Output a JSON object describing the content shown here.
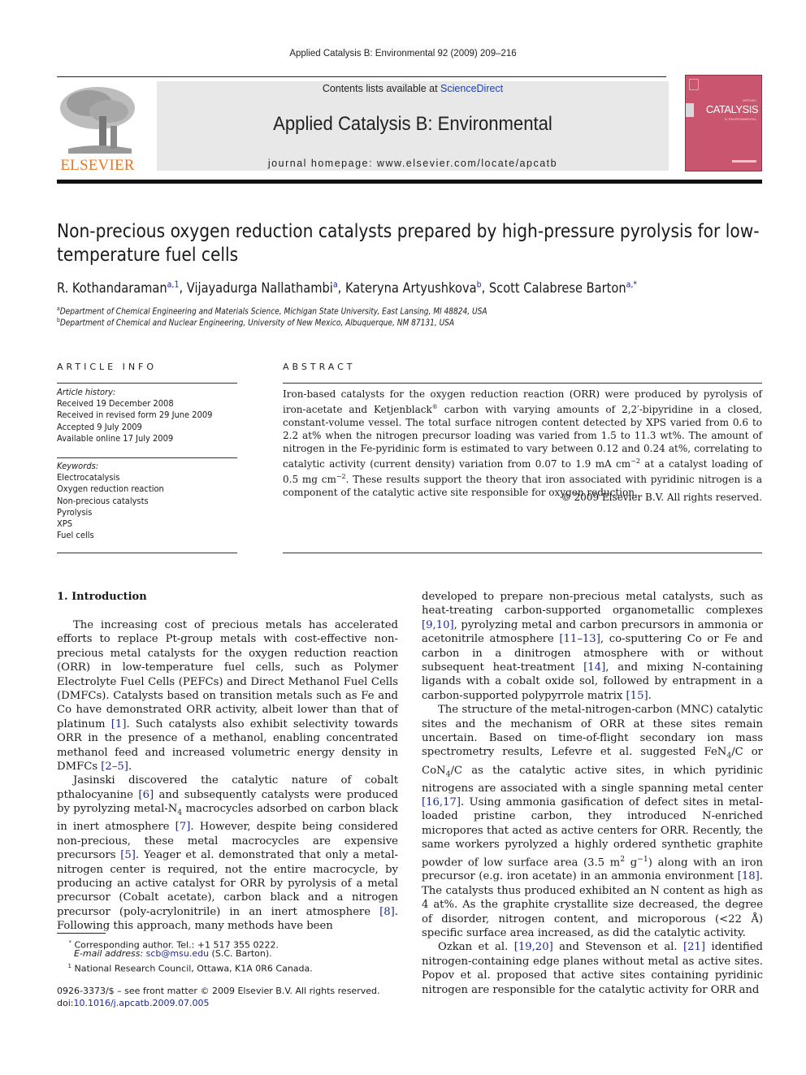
{
  "journal": {
    "running_head": "Applied Catalysis B: Environmental 92 (2009) 209–216",
    "contents_prefix": "Contents lists available at ",
    "contents_link": "ScienceDirect",
    "title": "Applied Catalysis B: Environmental",
    "homepage": "journal homepage: www.elsevier.com/locate/apcatb",
    "publisher_logo_text": "ELSEVIER",
    "cover": {
      "brand": "APPLIED",
      "title": "CATALYSIS",
      "subtitle": "B: ENVIRONMENTAL"
    },
    "colors": {
      "publisher_orange": "#e87722",
      "link_blue": "#1f2a8c",
      "cover_pink": "#c9566e",
      "banner_gray": "#e8e8e8"
    }
  },
  "article": {
    "title": "Non-precious oxygen reduction catalysts prepared by high-pressure pyrolysis for low-temperature fuel cells",
    "authors": [
      {
        "name": "R. Kothandaraman",
        "sup": "a,1",
        "sep": ", "
      },
      {
        "name": "Vijayadurga Nallathambi",
        "sup": "a",
        "sep": ", "
      },
      {
        "name": "Kateryna Artyushkova",
        "sup": "b",
        "sep": ", "
      },
      {
        "name": "Scott Calabrese Barton",
        "sup": "a,*",
        "sep": ""
      }
    ],
    "affiliations": [
      {
        "mark": "a",
        "text": "Department of Chemical Engineering and Materials Science, Michigan State University, East Lansing, MI 48824, USA"
      },
      {
        "mark": "b",
        "text": "Department of Chemical and Nuclear Engineering, University of New Mexico, Albuquerque, NM 87131, USA"
      }
    ]
  },
  "article_info": {
    "heading": "ARTICLE INFO",
    "history_label": "Article history:",
    "history": [
      "Received 19 December 2008",
      "Received in revised form 29 June 2009",
      "Accepted 9 July 2009",
      "Available online 17 July 2009"
    ],
    "keywords_label": "Keywords:",
    "keywords": [
      "Electrocatalysis",
      "Oxygen reduction reaction",
      "Non-precious catalysts",
      "Pyrolysis",
      "XPS",
      "Fuel cells"
    ]
  },
  "abstract": {
    "heading": "ABSTRACT",
    "p1": "Iron-based catalysts for the oxygen reduction reaction (ORR) were produced by pyrolysis of iron-acetate and Ketjenblack",
    "reg": "®",
    "p2": " carbon with varying amounts of 2,2′-bipyridine in a closed, constant-volume vessel. The total surface nitrogen content detected by XPS varied from 0.6 to 2.2 at% when the nitrogen precursor loading was varied from 1.5 to 11.3 wt%. The amount of nitrogen in the Fe-pyridinic form is estimated to vary between 0.12 and 0.24 at%, correlating to catalytic activity (current density) variation from 0.07 to 1.9 mA cm",
    "exp1": "−2",
    "p3": " at a catalyst loading of 0.5 mg cm",
    "exp2": "−2",
    "p4": ". These results support the theory that iron associated with pyridinic nitrogen is a component of the catalytic active site responsible for oxygen reduction.",
    "copyright": "© 2009 Elsevier B.V. All rights reserved."
  },
  "body": {
    "section_heading": "1.  Introduction",
    "left": {
      "p1": [
        {
          "t": "The increasing cost of precious metals has accelerated efforts to replace Pt-group metals with cost-effective non-precious metal catalysts for the oxygen reduction reaction (ORR) in low-temperature fuel cells, such as Polymer Electrolyte Fuel Cells (PEFCs) and Direct Methanol Fuel Cells (DMFCs). Catalysts based on transition metals such as Fe and Co have demonstrated ORR activity, albeit lower than that of platinum "
        },
        {
          "c": "[1]"
        },
        {
          "t": ". Such catalysts also exhibit selectivity towards ORR in the presence of a methanol, enabling concentrated methanol feed and increased volumetric energy density in DMFCs "
        },
        {
          "c": "[2–5]"
        },
        {
          "t": "."
        }
      ],
      "p2": [
        {
          "t": "Jasinski discovered the catalytic nature of cobalt pthalocyanine "
        },
        {
          "c": "[6]"
        },
        {
          "t": " and subsequently catalysts were produced by pyrolyzing metal-N"
        },
        {
          "s": "4"
        },
        {
          "t": " macrocycles adsorbed on carbon black in inert atmosphere "
        },
        {
          "c": "[7]"
        },
        {
          "t": ". However, despite being considered non-precious, these metal macrocycles are expensive precursors "
        },
        {
          "c": "[5]"
        },
        {
          "t": ". Yeager et al. demonstrated that only a metal-nitrogen center is required, not the entire macrocycle, by producing an active catalyst for ORR by pyrolysis of a metal precursor (Cobalt acetate), carbon black and a nitrogen precursor (poly-acrylonitrile) in an inert atmosphere "
        },
        {
          "c": "[8]"
        },
        {
          "t": ". Following this approach, many methods have been"
        }
      ]
    },
    "right": {
      "p1": [
        {
          "t": "developed to prepare non-precious metal catalysts, such as heat-treating carbon-supported organometallic complexes "
        },
        {
          "c": "[9,10]"
        },
        {
          "t": ", pyrolyzing metal and carbon precursors in ammonia or acetonitrile atmosphere "
        },
        {
          "c": "[11–13]"
        },
        {
          "t": ", co-sputtering Co or Fe and carbon in a dinitrogen atmosphere with or without subsequent heat-treatment "
        },
        {
          "c": "[14]"
        },
        {
          "t": ", and mixing N-containing ligands with a cobalt oxide sol, followed by entrapment in a carbon-supported polypyrrole matrix "
        },
        {
          "c": "[15]"
        },
        {
          "t": "."
        }
      ],
      "p2": [
        {
          "t": "The structure of the metal-nitrogen-carbon (MNC) catalytic sites and the mechanism of ORR at these sites remain uncertain. Based on time-of-flight secondary ion mass spectrometry results, Lefevre et al. suggested FeN"
        },
        {
          "s": "4"
        },
        {
          "t": "/C or CoN"
        },
        {
          "s": "4"
        },
        {
          "t": "/C as the catalytic active sites, in which pyridinic nitrogens are associated with a single spanning metal center "
        },
        {
          "c": "[16,17]"
        },
        {
          "t": ". Using ammonia gasification of defect sites in metal-loaded pristine carbon, they introduced N-enriched micropores that acted as active centers for ORR. Recently, the same workers pyrolyzed a highly ordered synthetic graphite powder of low surface area (3.5 m"
        },
        {
          "u": "2"
        },
        {
          "t": " g"
        },
        {
          "u": "−1"
        },
        {
          "t": ") along with an iron precursor (e.g. iron acetate) in an ammonia environment "
        },
        {
          "c": "[18]"
        },
        {
          "t": ". The catalysts thus produced exhibited an N content as high as 4 at%. As the graphite crystallite size decreased, the degree of disorder, nitrogen content, and microporous (<22 Å) specific surface area increased, as did the catalytic activity."
        }
      ],
      "p3": [
        {
          "t": "Ozkan et al. "
        },
        {
          "c": "[19,20]"
        },
        {
          "t": " and Stevenson et al. "
        },
        {
          "c": "[21]"
        },
        {
          "t": " identified nitrogen-containing edge planes without metal as active sites. Popov et al. proposed that active sites containing pyridinic nitrogen are responsible for the catalytic activity for ORR and"
        }
      ]
    }
  },
  "footnotes": {
    "corresponding_mark": "*",
    "corresponding": "Corresponding author. Tel.: +1 517 355 0222.",
    "email_label": "E-mail address: ",
    "email": "scb@msu.edu",
    "email_suffix": " (S.C. Barton).",
    "note1_mark": "1",
    "note1": "National Research Council, Ottawa, K1A 0R6 Canada.",
    "front_matter": "0926-3373/$ – see front matter © 2009 Elsevier B.V. All rights reserved.",
    "doi_label": "doi:",
    "doi": "10.1016/j.apcatb.2009.07.005"
  }
}
